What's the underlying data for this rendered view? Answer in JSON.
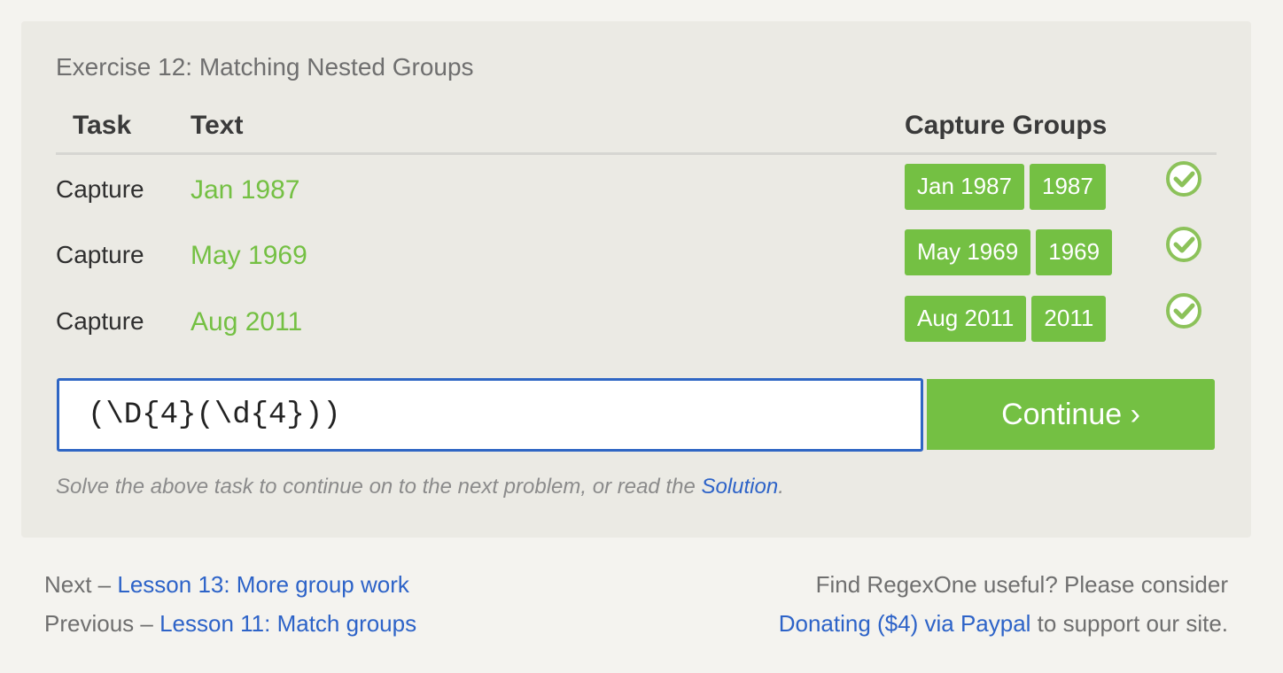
{
  "exercise": {
    "title": "Exercise 12: Matching Nested Groups",
    "headers": {
      "task": "Task",
      "text": "Text",
      "groups": "Capture Groups"
    },
    "rows": [
      {
        "task": "Capture",
        "text": "Jan 1987",
        "groups": [
          "Jan 1987",
          "1987"
        ],
        "status": "check-icon"
      },
      {
        "task": "Capture",
        "text": "May 1969",
        "groups": [
          "May 1969",
          "1969"
        ],
        "status": "check-icon"
      },
      {
        "task": "Capture",
        "text": "Aug 2011",
        "groups": [
          "Aug 2011",
          "2011"
        ],
        "status": "check-icon"
      }
    ],
    "input_value": "(\\D{4}(\\d{4}))",
    "continue_label": "Continue ›",
    "hint_prefix": "Solve the above task to continue on to the next problem, or read the ",
    "hint_link": "Solution",
    "hint_suffix": "."
  },
  "footer": {
    "next_prefix": "Next – ",
    "next_link": "Lesson 13: More group work",
    "prev_prefix": "Previous – ",
    "prev_link": "Lesson 11: Match groups",
    "donate_line1": "Find RegexOne useful? Please consider",
    "donate_link": "Donating ($4) via Paypal",
    "donate_suffix": " to support our site."
  },
  "colors": {
    "accent_green": "#74c043",
    "link_blue": "#2d63c8",
    "panel_bg": "#ebeae4"
  }
}
